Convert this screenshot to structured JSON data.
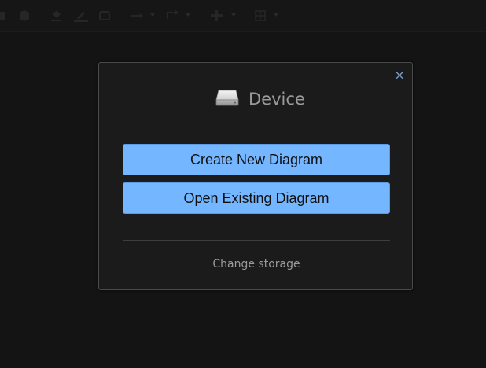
{
  "toolbar": {
    "icons": [
      "shadow-icon",
      "move-icon",
      "fill-color-icon",
      "line-color-icon",
      "shape-icon",
      "connection-icon",
      "waypoints-icon",
      "insert-icon",
      "table-icon"
    ]
  },
  "dialog": {
    "title": "Device",
    "close_symbol": "×",
    "create_label": "Create New Diagram",
    "open_label": "Open Existing Diagram",
    "change_storage_label": "Change storage"
  },
  "colors": {
    "background": "#141414",
    "dialog_bg": "#1b1b1b",
    "button_blue": "#74b6ff",
    "close_blue": "#7b9cc8"
  }
}
